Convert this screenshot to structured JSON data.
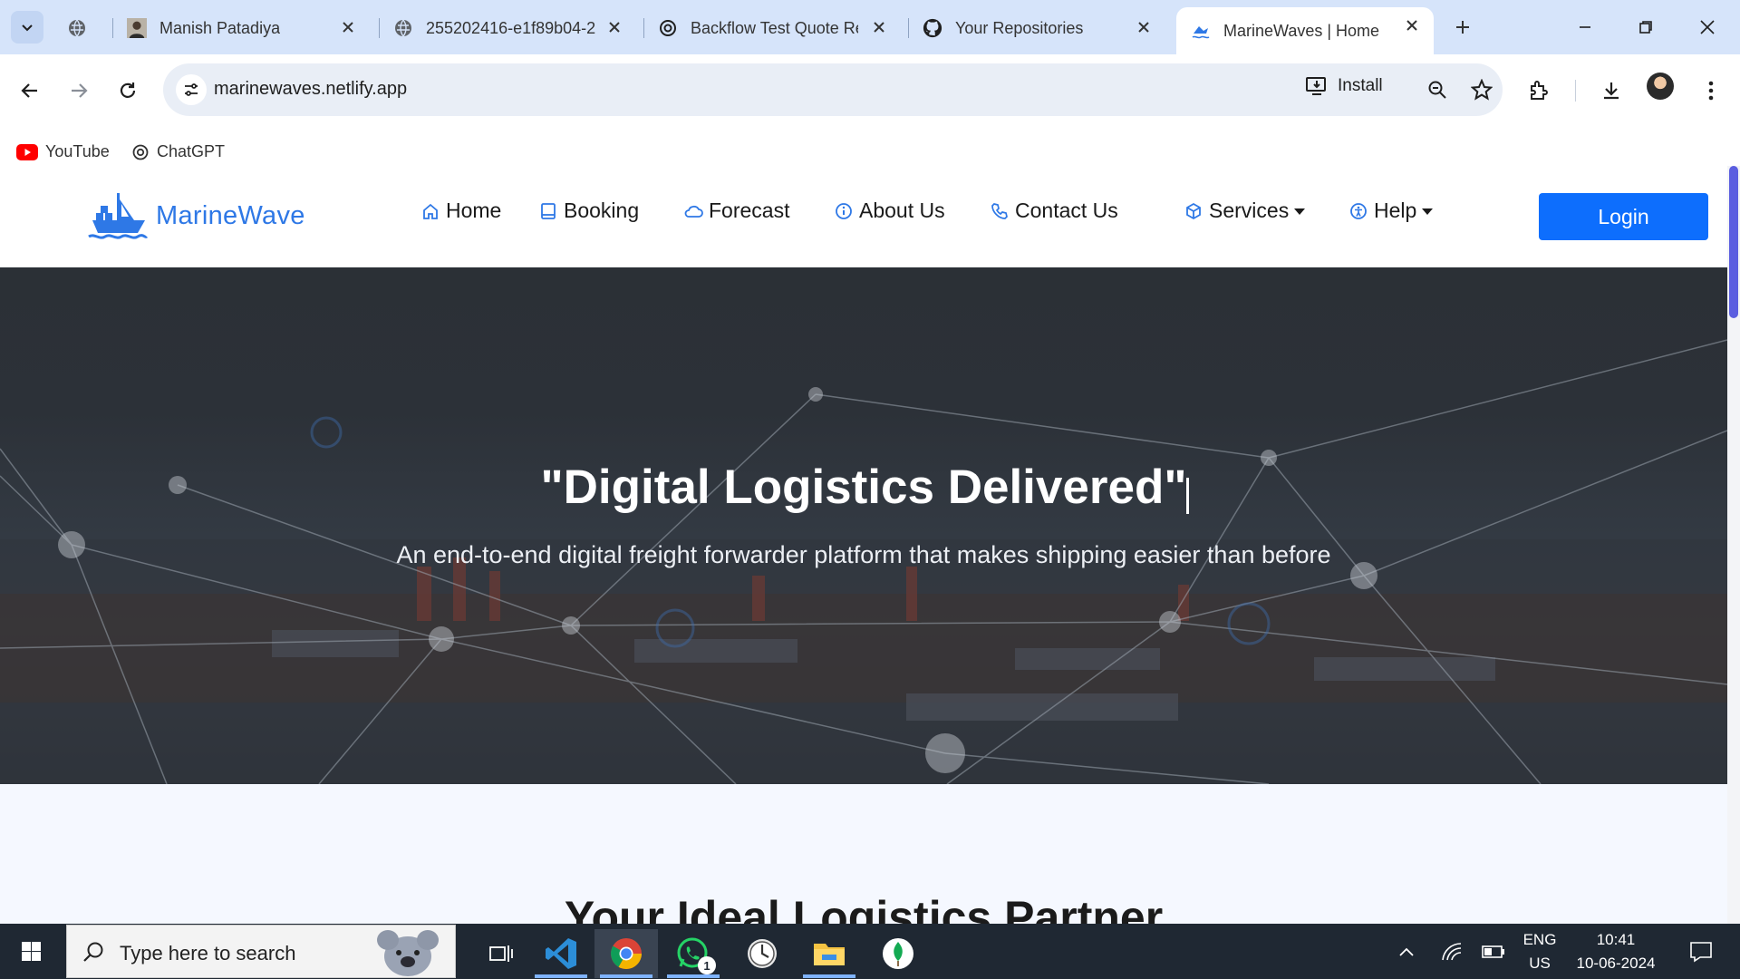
{
  "browser": {
    "tabs": [
      {
        "title": ""
      },
      {
        "title": "Manish Patadiya"
      },
      {
        "title": "255202416-e1f89b04-2"
      },
      {
        "title": "Backflow Test Quote Re"
      },
      {
        "title": "Your Repositories"
      },
      {
        "title": "MarineWaves | Home",
        "active": true
      }
    ],
    "url": "marinewaves.netlify.app",
    "install_label": "Install",
    "bookmarks": [
      {
        "label": "YouTube",
        "icon": "youtube-icon"
      },
      {
        "label": "ChatGPT",
        "icon": "chatgpt-icon"
      }
    ]
  },
  "site": {
    "brand": "MarineWave",
    "nav": {
      "home": "Home",
      "booking": "Booking",
      "forecast": "Forecast",
      "about": "About Us",
      "contact": "Contact Us",
      "services": "Services",
      "help": "Help"
    },
    "login_label": "Login",
    "hero": {
      "title": "\"Digital Logistics Delivered\"",
      "subtitle": "An end-to-end digital freight forwarder platform that makes shipping easier than before"
    },
    "section_title": "Your Ideal Logistics Partner"
  },
  "taskbar": {
    "search_placeholder": "Type here to search",
    "whatsapp_badge": "1",
    "lang_top": "ENG",
    "lang_bottom": "US",
    "time": "10:41",
    "date": "10-06-2024"
  },
  "colors": {
    "accent": "#0d6efd",
    "brand": "#2e78e6",
    "tabstrip": "#d6e4fa",
    "taskbar": "#1f2833"
  }
}
